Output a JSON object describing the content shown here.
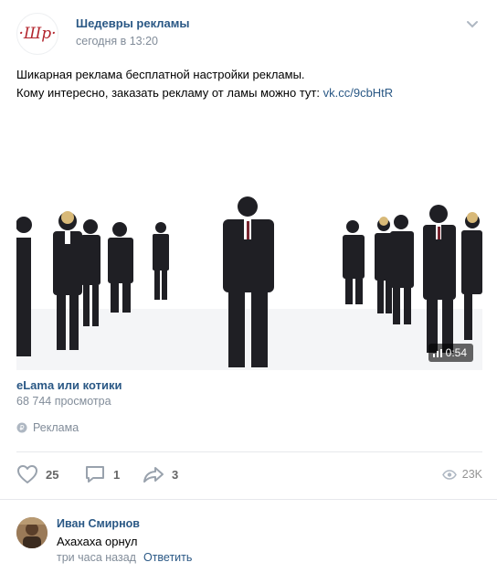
{
  "post": {
    "community_name": "Шедевры рекламы",
    "time": "сегодня в 13:20",
    "avatar_text": "·Шр·",
    "text_line1": "Шикарная реклама бесплатной настройки рекламы.",
    "text_line2": "Кому интересно, заказать рекламу от ламы можно тут: ",
    "link": "vk.cc/9cbHtR"
  },
  "video": {
    "title": "eLama или котики",
    "views": "68 744 просмотра",
    "duration": "0:54",
    "ad_label": "Реклама"
  },
  "actions": {
    "likes": "25",
    "comments": "1",
    "shares": "3",
    "views": "23K"
  },
  "comment": {
    "author": "Иван Смирнов",
    "text": "Ахахаха орнул",
    "time": "три часа назад",
    "reply": "Ответить"
  },
  "colors": {
    "link": "#2a5885",
    "muted": "#818c99",
    "brand_red": "#b3262e"
  }
}
